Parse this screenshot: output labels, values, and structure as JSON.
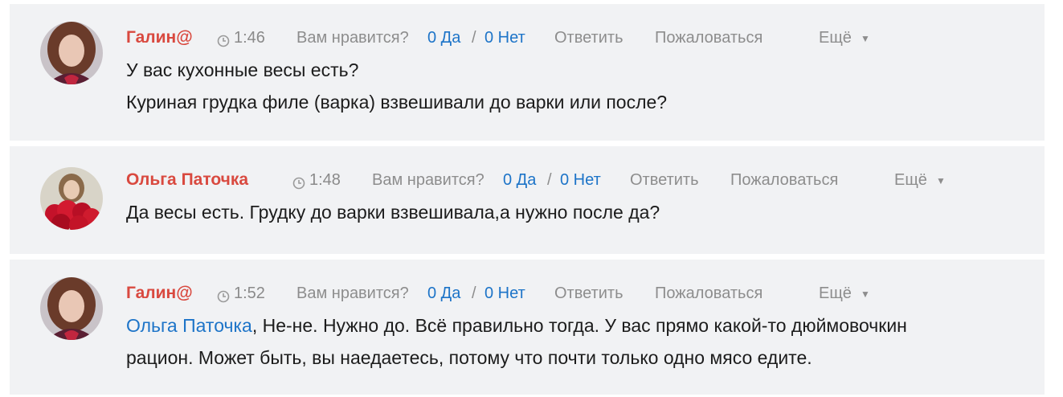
{
  "comments": [
    {
      "author": "Галин@",
      "time": "1:46",
      "like_prompt": "Вам нравится?",
      "yes": "0 Да",
      "slash": "/",
      "no": "0 Нет",
      "reply": "Ответить",
      "report": "Пожаловаться",
      "more": "Ещё",
      "lines": [
        "У вас кухонные весы есть?",
        "Куриная грудка филе (варка) взвешивали до варки или после?"
      ]
    },
    {
      "author": "Ольга Паточка",
      "time": "1:48",
      "like_prompt": "Вам нравится?",
      "yes": "0 Да",
      "slash": "/",
      "no": "0 Нет",
      "reply": "Ответить",
      "report": "Пожаловаться",
      "more": "Ещё",
      "lines": [
        "Да весы есть. Грудку до варки взвешивала,а нужно после да?"
      ]
    },
    {
      "author": "Галин@",
      "time": "1:52",
      "like_prompt": "Вам нравится?",
      "yes": "0 Да",
      "slash": "/",
      "no": "0 Нет",
      "reply": "Ответить",
      "report": "Пожаловаться",
      "more": "Ещё",
      "mention": "Ольга Паточка",
      "lines": [
        ", Не-не. Нужно до. Всё правильно тогда. У вас прямо какой-то дюймовочкин",
        "рацион. Может быть, вы наедаетесь, потому что почти только одно мясо едите."
      ]
    }
  ],
  "icons": {
    "clock": "clock-icon",
    "caret": "caret-down-icon"
  },
  "colors": {
    "author": "#d9493f",
    "link": "#1d74c8",
    "muted": "#8d8d8d",
    "card": "#f1f2f4"
  }
}
